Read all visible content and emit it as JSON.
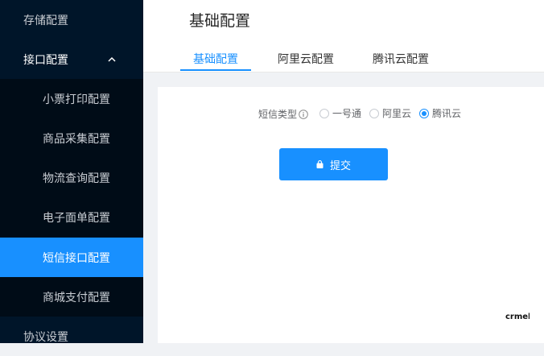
{
  "sidebar": {
    "items": [
      {
        "label": "存储配置"
      },
      {
        "label": "接口配置"
      },
      {
        "label": "小票打印配置"
      },
      {
        "label": "商品采集配置"
      },
      {
        "label": "物流查询配置"
      },
      {
        "label": "电子面单配置"
      },
      {
        "label": "短信接口配置"
      },
      {
        "label": "商城支付配置"
      },
      {
        "label": "协议设置"
      }
    ],
    "active_item": "短信接口配置",
    "expanded_group": "接口配置"
  },
  "header": {
    "title": "基础配置",
    "tabs": [
      {
        "label": "基础配置"
      },
      {
        "label": "阿里云配置"
      },
      {
        "label": "腾讯云配置"
      }
    ],
    "active_tab": "基础配置"
  },
  "form": {
    "sms_type_label": "短信类型",
    "options": [
      {
        "label": "一号通"
      },
      {
        "label": "阿里云"
      },
      {
        "label": "腾讯云"
      }
    ],
    "selected_option": "腾讯云",
    "submit_label": "提交"
  },
  "colors": {
    "accent": "#1890ff",
    "sidebar_bg": "#001529",
    "submenu_bg": "#000c17"
  },
  "icons": {
    "chevron": "chevron-up-icon",
    "info": "info-icon",
    "submit": "lock-icon",
    "logo": "crmeb-logo"
  }
}
